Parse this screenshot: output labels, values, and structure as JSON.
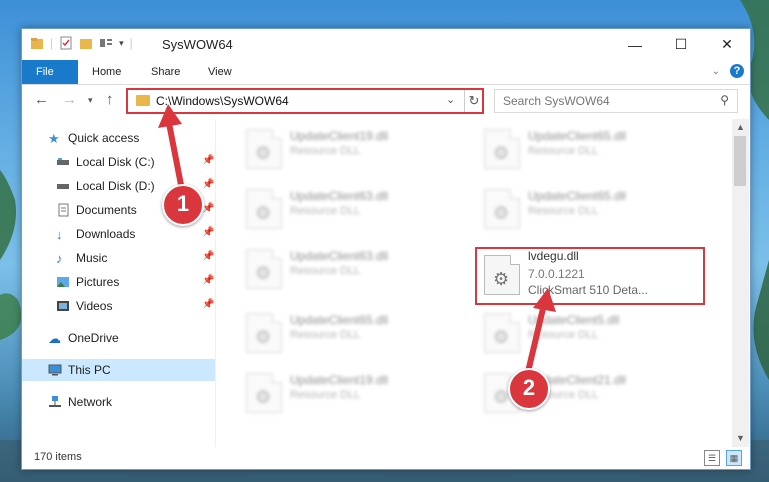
{
  "window": {
    "title": "SysWOW64",
    "controls": {
      "minimize": "—",
      "maximize": "☐",
      "close": "✕"
    }
  },
  "ribbon": {
    "tabs": [
      "File",
      "Home",
      "Share",
      "View"
    ],
    "help": "?"
  },
  "address_bar": {
    "path": "C:\\Windows\\SysWOW64"
  },
  "search": {
    "placeholder": "Search SysWOW64"
  },
  "nav_pane": {
    "items": [
      {
        "label": "Quick access",
        "icon": "star-icon",
        "pinned": false
      },
      {
        "label": "Local Disk (C:)",
        "icon": "drive-icon",
        "pinned": true
      },
      {
        "label": "Local Disk (D:)",
        "icon": "drive-icon",
        "pinned": true
      },
      {
        "label": "Documents",
        "icon": "documents-icon",
        "pinned": true
      },
      {
        "label": "Downloads",
        "icon": "download-icon",
        "pinned": true
      },
      {
        "label": "Music",
        "icon": "music-icon",
        "pinned": true
      },
      {
        "label": "Pictures",
        "icon": "pictures-icon",
        "pinned": true
      },
      {
        "label": "Videos",
        "icon": "videos-icon",
        "pinned": true
      },
      {
        "label": "OneDrive",
        "icon": "cloud-icon",
        "pinned": false
      },
      {
        "label": "This PC",
        "icon": "computer-icon",
        "pinned": false,
        "selected": true
      },
      {
        "label": "Network",
        "icon": "network-icon",
        "pinned": false
      }
    ]
  },
  "files": [
    {
      "name": "UpdateClient19.dll",
      "type": "Resource DLL",
      "blurred": true
    },
    {
      "name": "UpdateClient65.dll",
      "type": "Resource DLL",
      "blurred": true
    },
    {
      "name": "UpdateClient63.dll",
      "type": "Resource DLL",
      "blurred": true
    },
    {
      "name": "UpdateClient65.dll",
      "type": "Resource DLL",
      "blurred": true
    },
    {
      "name": "UpdateClient63.dll",
      "type": "Resource DLL",
      "blurred": true
    },
    {
      "name": "lvdegu.dll",
      "type": "7.0.0.1221",
      "desc": "ClickSmart 510 Deta...",
      "blurred": false
    },
    {
      "name": "UpdateClient65.dll",
      "type": "Resource DLL",
      "blurred": true
    },
    {
      "name": "UpdateClient5.dll",
      "type": "Resource DLL",
      "blurred": true
    },
    {
      "name": "UpdateClient19.dll",
      "type": "Resource DLL",
      "blurred": true
    },
    {
      "name": "UpdateClient21.dll",
      "type": "Resource DLL",
      "blurred": true
    }
  ],
  "status": {
    "item_count": "170 items"
  },
  "annotations": {
    "badge1": "1",
    "badge2": "2",
    "color": "#d9363e"
  }
}
